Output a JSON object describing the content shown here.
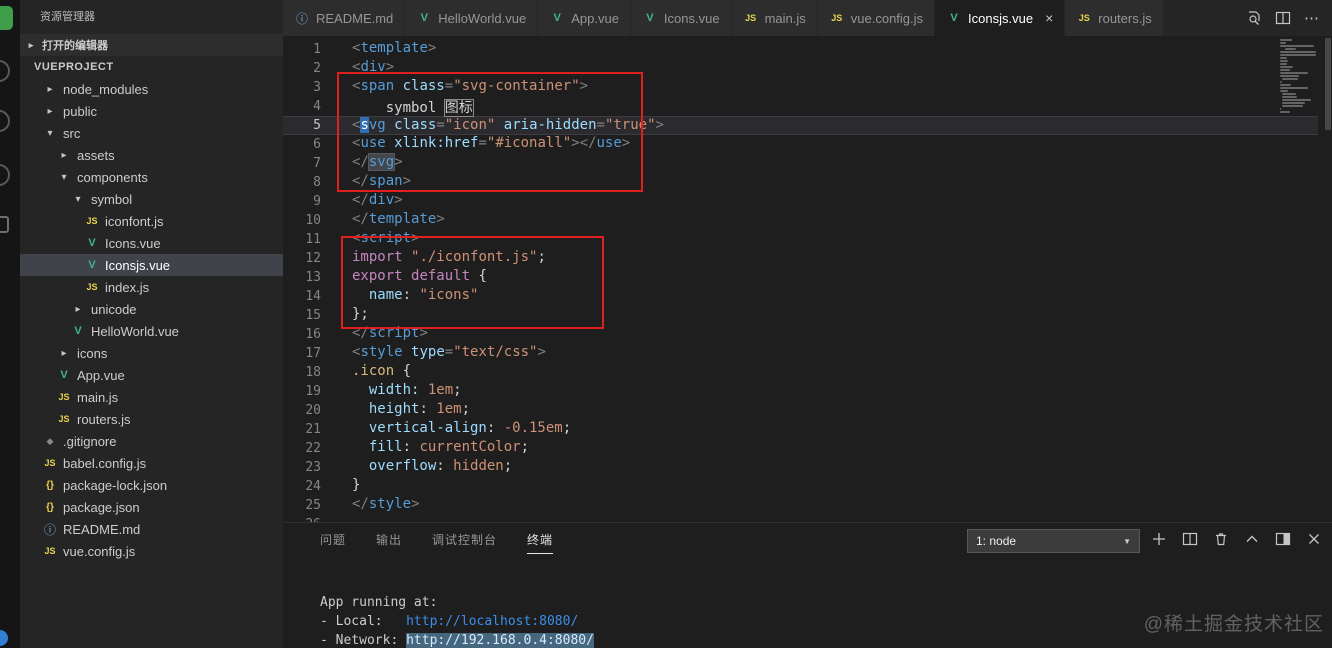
{
  "glyphs": {
    "close": "×",
    "dropdown": "▼",
    "chevron_collapsed": "▸",
    "chevron_expanded": "▾",
    "more": "⋯"
  },
  "colors": {
    "annotation_red": "#e01f1f",
    "vue_green": "#41b883",
    "js_yellow": "#e8d44d",
    "link_blue": "#3b8eea",
    "editor_bg": "#1e1e1e",
    "sidebar_bg": "#252526"
  },
  "sidebar": {
    "title": "资源管理器",
    "sections": {
      "open_editors": "打开的编辑器",
      "project": "VUEPROJECT"
    },
    "tree": [
      {
        "label": "node_modules",
        "kind": "folder",
        "expanded": false,
        "indent": 0
      },
      {
        "label": "public",
        "kind": "folder",
        "expanded": false,
        "indent": 0
      },
      {
        "label": "src",
        "kind": "folder",
        "expanded": true,
        "indent": 0
      },
      {
        "label": "assets",
        "kind": "folder",
        "expanded": false,
        "indent": 1
      },
      {
        "label": "components",
        "kind": "folder",
        "expanded": true,
        "indent": 1
      },
      {
        "label": "symbol",
        "kind": "folder",
        "expanded": true,
        "indent": 2
      },
      {
        "label": "iconfont.js",
        "kind": "js",
        "indent": 3
      },
      {
        "label": "Icons.vue",
        "kind": "vue",
        "indent": 3
      },
      {
        "label": "Iconsjs.vue",
        "kind": "vue",
        "indent": 3,
        "selected": true
      },
      {
        "label": "index.js",
        "kind": "js",
        "indent": 3
      },
      {
        "label": "unicode",
        "kind": "folder",
        "expanded": false,
        "indent": 2
      },
      {
        "label": "HelloWorld.vue",
        "kind": "vue",
        "indent": 2
      },
      {
        "label": "icons",
        "kind": "folder",
        "expanded": false,
        "indent": 1
      },
      {
        "label": "App.vue",
        "kind": "vue",
        "indent": 1
      },
      {
        "label": "main.js",
        "kind": "js",
        "indent": 1
      },
      {
        "label": "routers.js",
        "kind": "js",
        "indent": 1
      },
      {
        "label": ".gitignore",
        "kind": "file",
        "indent": 0
      },
      {
        "label": "babel.config.js",
        "kind": "js",
        "indent": 0
      },
      {
        "label": "package-lock.json",
        "kind": "json",
        "indent": 0
      },
      {
        "label": "package.json",
        "kind": "json",
        "indent": 0
      },
      {
        "label": "README.md",
        "kind": "info",
        "indent": 0
      },
      {
        "label": "vue.config.js",
        "kind": "js",
        "indent": 0
      }
    ]
  },
  "tabs": [
    {
      "label": "README.md",
      "icon": "info"
    },
    {
      "label": "HelloWorld.vue",
      "icon": "vue"
    },
    {
      "label": "App.vue",
      "icon": "vue"
    },
    {
      "label": "Icons.vue",
      "icon": "vue"
    },
    {
      "label": "main.js",
      "icon": "js"
    },
    {
      "label": "vue.config.js",
      "icon": "js"
    },
    {
      "label": "Iconsjs.vue",
      "icon": "vue",
      "active": true
    },
    {
      "label": "routers.js",
      "icon": "js"
    }
  ],
  "editor": {
    "lines": [
      {
        "tokens": [
          {
            "t": "<",
            "c": "p"
          },
          {
            "t": "template",
            "c": "tag"
          },
          {
            "t": ">",
            "c": "p"
          }
        ]
      },
      {
        "tokens": [
          {
            "t": "<",
            "c": "p"
          },
          {
            "t": "div",
            "c": "tag"
          },
          {
            "t": ">",
            "c": "p"
          }
        ]
      },
      {
        "tokens": [
          {
            "t": "<",
            "c": "p"
          },
          {
            "t": "span",
            "c": "tag"
          },
          {
            "t": " ",
            "c": "txt"
          },
          {
            "t": "class",
            "c": "attr"
          },
          {
            "t": "=",
            "c": "p"
          },
          {
            "t": "\"svg-container\"",
            "c": "str"
          },
          {
            "t": ">",
            "c": "p"
          }
        ]
      },
      {
        "tokens": [
          {
            "t": "    symbol ",
            "c": "txt"
          },
          {
            "t": "图标",
            "c": "box"
          }
        ]
      },
      {
        "cur": true,
        "tokens": [
          {
            "t": "<",
            "c": "p"
          },
          {
            "t": "s",
            "c": "sel"
          },
          {
            "t": "vg",
            "c": "tag"
          },
          {
            "t": " ",
            "c": "txt"
          },
          {
            "t": "class",
            "c": "attr"
          },
          {
            "t": "=",
            "c": "p"
          },
          {
            "t": "\"icon\"",
            "c": "str"
          },
          {
            "t": " ",
            "c": "txt"
          },
          {
            "t": "aria-hidden",
            "c": "attr"
          },
          {
            "t": "=",
            "c": "p"
          },
          {
            "t": "\"true\"",
            "c": "str"
          },
          {
            "t": ">",
            "c": "p"
          }
        ]
      },
      {
        "tokens": [
          {
            "t": "<",
            "c": "p"
          },
          {
            "t": "use",
            "c": "tag"
          },
          {
            "t": " ",
            "c": "txt"
          },
          {
            "t": "xlink:href",
            "c": "attr"
          },
          {
            "t": "=",
            "c": "p"
          },
          {
            "t": "\"#iconall\"",
            "c": "str"
          },
          {
            "t": ">",
            "c": "p"
          },
          {
            "t": "</",
            "c": "p"
          },
          {
            "t": "use",
            "c": "tag"
          },
          {
            "t": ">",
            "c": "p"
          }
        ]
      },
      {
        "tokens": [
          {
            "t": "</",
            "c": "p"
          },
          {
            "t": "svg",
            "c": "taghl"
          },
          {
            "t": ">",
            "c": "p"
          }
        ]
      },
      {
        "tokens": [
          {
            "t": "</",
            "c": "p"
          },
          {
            "t": "span",
            "c": "tag"
          },
          {
            "t": ">",
            "c": "p"
          }
        ]
      },
      {
        "tokens": [
          {
            "t": "</",
            "c": "p"
          },
          {
            "t": "div",
            "c": "tag"
          },
          {
            "t": ">",
            "c": "p"
          }
        ]
      },
      {
        "tokens": [
          {
            "t": "</",
            "c": "p"
          },
          {
            "t": "template",
            "c": "tag"
          },
          {
            "t": ">",
            "c": "p"
          }
        ]
      },
      {
        "tokens": [
          {
            "t": "<",
            "c": "p"
          },
          {
            "t": "script",
            "c": "tag"
          },
          {
            "t": ">",
            "c": "p"
          }
        ]
      },
      {
        "tokens": [
          {
            "t": "import",
            "c": "kw"
          },
          {
            "t": " ",
            "c": "txt"
          },
          {
            "t": "\"./iconfont.js\"",
            "c": "str"
          },
          {
            "t": ";",
            "c": "txt"
          }
        ]
      },
      {
        "tokens": [
          {
            "t": "export",
            "c": "kw"
          },
          {
            "t": " ",
            "c": "txt"
          },
          {
            "t": "default",
            "c": "kw"
          },
          {
            "t": " {",
            "c": "txt"
          }
        ]
      },
      {
        "tokens": [
          {
            "t": "  name",
            "c": "attr"
          },
          {
            "t": ": ",
            "c": "txt"
          },
          {
            "t": "\"icons\"",
            "c": "str"
          }
        ]
      },
      {
        "tokens": [
          {
            "t": "};",
            "c": "txt"
          }
        ]
      },
      {
        "tokens": [
          {
            "t": "</",
            "c": "p"
          },
          {
            "t": "script",
            "c": "tag"
          },
          {
            "t": ">",
            "c": "p"
          }
        ]
      },
      {
        "tokens": [
          {
            "t": "<",
            "c": "p"
          },
          {
            "t": "style",
            "c": "tag"
          },
          {
            "t": " ",
            "c": "txt"
          },
          {
            "t": "type",
            "c": "attr"
          },
          {
            "t": "=",
            "c": "p"
          },
          {
            "t": "\"text/css\"",
            "c": "str"
          },
          {
            "t": ">",
            "c": "p"
          }
        ]
      },
      {
        "tokens": [
          {
            "t": ".icon",
            "c": "cls"
          },
          {
            "t": " {",
            "c": "txt"
          }
        ]
      },
      {
        "tokens": [
          {
            "t": "  width",
            "c": "prop"
          },
          {
            "t": ": ",
            "c": "txt"
          },
          {
            "t": "1em",
            "c": "val"
          },
          {
            "t": ";",
            "c": "txt"
          }
        ]
      },
      {
        "tokens": [
          {
            "t": "  height",
            "c": "prop"
          },
          {
            "t": ": ",
            "c": "txt"
          },
          {
            "t": "1em",
            "c": "val"
          },
          {
            "t": ";",
            "c": "txt"
          }
        ]
      },
      {
        "tokens": [
          {
            "t": "  vertical-align",
            "c": "prop"
          },
          {
            "t": ": ",
            "c": "txt"
          },
          {
            "t": "-0.15em",
            "c": "val"
          },
          {
            "t": ";",
            "c": "txt"
          }
        ]
      },
      {
        "tokens": [
          {
            "t": "  fill",
            "c": "prop"
          },
          {
            "t": ": ",
            "c": "txt"
          },
          {
            "t": "currentColor",
            "c": "val"
          },
          {
            "t": ";",
            "c": "txt"
          }
        ]
      },
      {
        "tokens": [
          {
            "t": "  overflow",
            "c": "prop"
          },
          {
            "t": ": ",
            "c": "txt"
          },
          {
            "t": "hidden",
            "c": "val"
          },
          {
            "t": ";",
            "c": "txt"
          }
        ]
      },
      {
        "tokens": [
          {
            "t": "}",
            "c": "txt"
          }
        ]
      },
      {
        "tokens": [
          {
            "t": "</",
            "c": "p"
          },
          {
            "t": "style",
            "c": "tag"
          },
          {
            "t": ">",
            "c": "p"
          }
        ]
      },
      {
        "tokens": []
      }
    ]
  },
  "panel": {
    "tabs": [
      {
        "label": "问题"
      },
      {
        "label": "输出"
      },
      {
        "label": "调试控制台"
      },
      {
        "label": "终端",
        "active": true
      }
    ],
    "terminal_select": "1: node",
    "terminal_lines": [
      {
        "text": "App running at:"
      },
      {
        "prefix": "- Local:   ",
        "url": "http://localhost:8080/"
      },
      {
        "prefix": "- Network: ",
        "url": "http://192.168.0.4:8080/",
        "highlighted": true
      }
    ]
  },
  "window": {
    "watermark": "@稀土掘金技术社区"
  }
}
